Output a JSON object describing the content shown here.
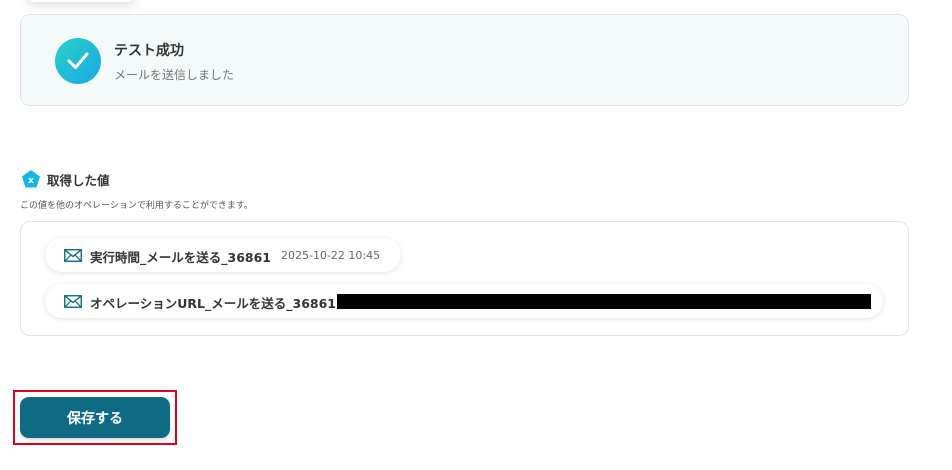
{
  "result": {
    "title": "テスト成功",
    "subtitle": "メールを送信しました",
    "icon": "check-circle-icon",
    "accent_color": "#1fc0d6"
  },
  "retrieved": {
    "title": "取得した値",
    "description": "この値を他のオペレーションで利用することができます。",
    "icon": "yoom-pentagon-icon",
    "items": [
      {
        "icon": "mail-icon",
        "label": "実行時間_メールを送る_36861",
        "value": "2025-10-22 10:45"
      },
      {
        "icon": "mail-icon",
        "label": "オペレーションURL_メールを送る_36861",
        "value": ""
      }
    ]
  },
  "actions": {
    "save_label": "保存する",
    "save_color": "#0e6b83",
    "highlight_color": "#e0001a"
  }
}
